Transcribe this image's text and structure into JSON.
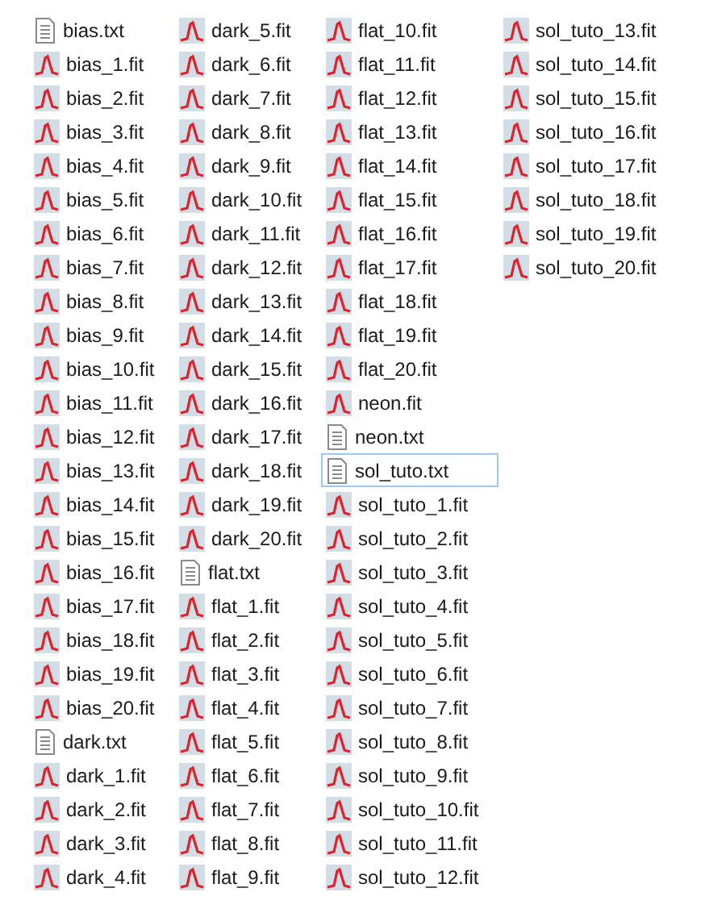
{
  "columns": [
    [
      {
        "name": "bias.txt",
        "kind": "text",
        "selected": false
      },
      {
        "name": "bias_1.fit",
        "kind": "fit",
        "selected": false
      },
      {
        "name": "bias_2.fit",
        "kind": "fit",
        "selected": false
      },
      {
        "name": "bias_3.fit",
        "kind": "fit",
        "selected": false
      },
      {
        "name": "bias_4.fit",
        "kind": "fit",
        "selected": false
      },
      {
        "name": "bias_5.fit",
        "kind": "fit",
        "selected": false
      },
      {
        "name": "bias_6.fit",
        "kind": "fit",
        "selected": false
      },
      {
        "name": "bias_7.fit",
        "kind": "fit",
        "selected": false
      },
      {
        "name": "bias_8.fit",
        "kind": "fit",
        "selected": false
      },
      {
        "name": "bias_9.fit",
        "kind": "fit",
        "selected": false
      },
      {
        "name": "bias_10.fit",
        "kind": "fit",
        "selected": false
      },
      {
        "name": "bias_11.fit",
        "kind": "fit",
        "selected": false
      },
      {
        "name": "bias_12.fit",
        "kind": "fit",
        "selected": false
      },
      {
        "name": "bias_13.fit",
        "kind": "fit",
        "selected": false
      },
      {
        "name": "bias_14.fit",
        "kind": "fit",
        "selected": false
      },
      {
        "name": "bias_15.fit",
        "kind": "fit",
        "selected": false
      },
      {
        "name": "bias_16.fit",
        "kind": "fit",
        "selected": false
      },
      {
        "name": "bias_17.fit",
        "kind": "fit",
        "selected": false
      },
      {
        "name": "bias_18.fit",
        "kind": "fit",
        "selected": false
      },
      {
        "name": "bias_19.fit",
        "kind": "fit",
        "selected": false
      },
      {
        "name": "bias_20.fit",
        "kind": "fit",
        "selected": false
      },
      {
        "name": "dark.txt",
        "kind": "text",
        "selected": false
      },
      {
        "name": "dark_1.fit",
        "kind": "fit",
        "selected": false
      },
      {
        "name": "dark_2.fit",
        "kind": "fit",
        "selected": false
      },
      {
        "name": "dark_3.fit",
        "kind": "fit",
        "selected": false
      },
      {
        "name": "dark_4.fit",
        "kind": "fit",
        "selected": false
      }
    ],
    [
      {
        "name": "dark_5.fit",
        "kind": "fit",
        "selected": false
      },
      {
        "name": "dark_6.fit",
        "kind": "fit",
        "selected": false
      },
      {
        "name": "dark_7.fit",
        "kind": "fit",
        "selected": false
      },
      {
        "name": "dark_8.fit",
        "kind": "fit",
        "selected": false
      },
      {
        "name": "dark_9.fit",
        "kind": "fit",
        "selected": false
      },
      {
        "name": "dark_10.fit",
        "kind": "fit",
        "selected": false
      },
      {
        "name": "dark_11.fit",
        "kind": "fit",
        "selected": false
      },
      {
        "name": "dark_12.fit",
        "kind": "fit",
        "selected": false
      },
      {
        "name": "dark_13.fit",
        "kind": "fit",
        "selected": false
      },
      {
        "name": "dark_14.fit",
        "kind": "fit",
        "selected": false
      },
      {
        "name": "dark_15.fit",
        "kind": "fit",
        "selected": false
      },
      {
        "name": "dark_16.fit",
        "kind": "fit",
        "selected": false
      },
      {
        "name": "dark_17.fit",
        "kind": "fit",
        "selected": false
      },
      {
        "name": "dark_18.fit",
        "kind": "fit",
        "selected": false
      },
      {
        "name": "dark_19.fit",
        "kind": "fit",
        "selected": false
      },
      {
        "name": "dark_20.fit",
        "kind": "fit",
        "selected": false
      },
      {
        "name": "flat.txt",
        "kind": "text",
        "selected": false
      },
      {
        "name": "flat_1.fit",
        "kind": "fit",
        "selected": false
      },
      {
        "name": "flat_2.fit",
        "kind": "fit",
        "selected": false
      },
      {
        "name": "flat_3.fit",
        "kind": "fit",
        "selected": false
      },
      {
        "name": "flat_4.fit",
        "kind": "fit",
        "selected": false
      },
      {
        "name": "flat_5.fit",
        "kind": "fit",
        "selected": false
      },
      {
        "name": "flat_6.fit",
        "kind": "fit",
        "selected": false
      },
      {
        "name": "flat_7.fit",
        "kind": "fit",
        "selected": false
      },
      {
        "name": "flat_8.fit",
        "kind": "fit",
        "selected": false
      },
      {
        "name": "flat_9.fit",
        "kind": "fit",
        "selected": false
      }
    ],
    [
      {
        "name": "flat_10.fit",
        "kind": "fit",
        "selected": false
      },
      {
        "name": "flat_11.fit",
        "kind": "fit",
        "selected": false
      },
      {
        "name": "flat_12.fit",
        "kind": "fit",
        "selected": false
      },
      {
        "name": "flat_13.fit",
        "kind": "fit",
        "selected": false
      },
      {
        "name": "flat_14.fit",
        "kind": "fit",
        "selected": false
      },
      {
        "name": "flat_15.fit",
        "kind": "fit",
        "selected": false
      },
      {
        "name": "flat_16.fit",
        "kind": "fit",
        "selected": false
      },
      {
        "name": "flat_17.fit",
        "kind": "fit",
        "selected": false
      },
      {
        "name": "flat_18.fit",
        "kind": "fit",
        "selected": false
      },
      {
        "name": "flat_19.fit",
        "kind": "fit",
        "selected": false
      },
      {
        "name": "flat_20.fit",
        "kind": "fit",
        "selected": false
      },
      {
        "name": "neon.fit",
        "kind": "fit",
        "selected": false
      },
      {
        "name": "neon.txt",
        "kind": "text",
        "selected": false
      },
      {
        "name": "sol_tuto.txt",
        "kind": "text",
        "selected": true
      },
      {
        "name": "sol_tuto_1.fit",
        "kind": "fit",
        "selected": false
      },
      {
        "name": "sol_tuto_2.fit",
        "kind": "fit",
        "selected": false
      },
      {
        "name": "sol_tuto_3.fit",
        "kind": "fit",
        "selected": false
      },
      {
        "name": "sol_tuto_4.fit",
        "kind": "fit",
        "selected": false
      },
      {
        "name": "sol_tuto_5.fit",
        "kind": "fit",
        "selected": false
      },
      {
        "name": "sol_tuto_6.fit",
        "kind": "fit",
        "selected": false
      },
      {
        "name": "sol_tuto_7.fit",
        "kind": "fit",
        "selected": false
      },
      {
        "name": "sol_tuto_8.fit",
        "kind": "fit",
        "selected": false
      },
      {
        "name": "sol_tuto_9.fit",
        "kind": "fit",
        "selected": false
      },
      {
        "name": "sol_tuto_10.fit",
        "kind": "fit",
        "selected": false
      },
      {
        "name": "sol_tuto_11.fit",
        "kind": "fit",
        "selected": false
      },
      {
        "name": "sol_tuto_12.fit",
        "kind": "fit",
        "selected": false
      }
    ],
    [
      {
        "name": "sol_tuto_13.fit",
        "kind": "fit",
        "selected": false
      },
      {
        "name": "sol_tuto_14.fit",
        "kind": "fit",
        "selected": false
      },
      {
        "name": "sol_tuto_15.fit",
        "kind": "fit",
        "selected": false
      },
      {
        "name": "sol_tuto_16.fit",
        "kind": "fit",
        "selected": false
      },
      {
        "name": "sol_tuto_17.fit",
        "kind": "fit",
        "selected": false
      },
      {
        "name": "sol_tuto_18.fit",
        "kind": "fit",
        "selected": false
      },
      {
        "name": "sol_tuto_19.fit",
        "kind": "fit",
        "selected": false
      },
      {
        "name": "sol_tuto_20.fit",
        "kind": "fit",
        "selected": false
      }
    ]
  ]
}
